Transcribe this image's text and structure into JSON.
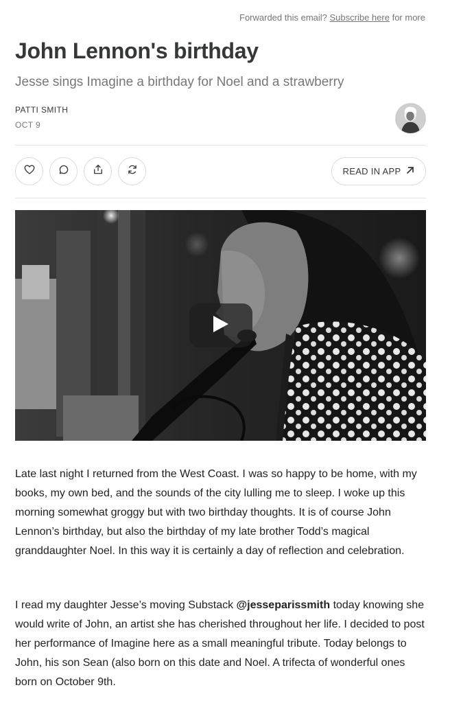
{
  "header": {
    "forward_prefix": "Forwarded this email?",
    "forward_link": "Subscribe here",
    "forward_suffix": "for more"
  },
  "post": {
    "title": "John Lennon's birthday",
    "subtitle": "Jesse sings Imagine a birthday for Noel and a strawberry",
    "author": "PATTI SMITH",
    "date": "OCT 9"
  },
  "actions": {
    "icons": [
      "heart-icon",
      "comment-icon",
      "share-icon",
      "restack-icon"
    ],
    "read_in_app": "READ IN APP"
  },
  "video": {
    "play_icon": "play-icon"
  },
  "body": {
    "p1": "Late last night I returned from the West Coast. I was so happy to be home, with my books, my own bed, and the sounds of the city lulling me to sleep. I woke up this morning somewhat groggy but with two birthday thoughts. It is of course John Lennon’s birthday, but also the birthday of my late brother Todd’s magical granddaughter Noel. In this way it is certainly a day of reflection and celebration.",
    "p2_before": "I read my daughter Jesse’s moving Substack",
    "p2_mention": "@jesseparissmith",
    "p2_after": "today knowing she would write of John, an artist she has cherished throughout her life. I decided to post her performance of Imagine here as a small meaningful tribute. Today belongs to John, his son Sean (also born on this date and Noel. A trifecta of wonderful ones born on October 9th."
  }
}
